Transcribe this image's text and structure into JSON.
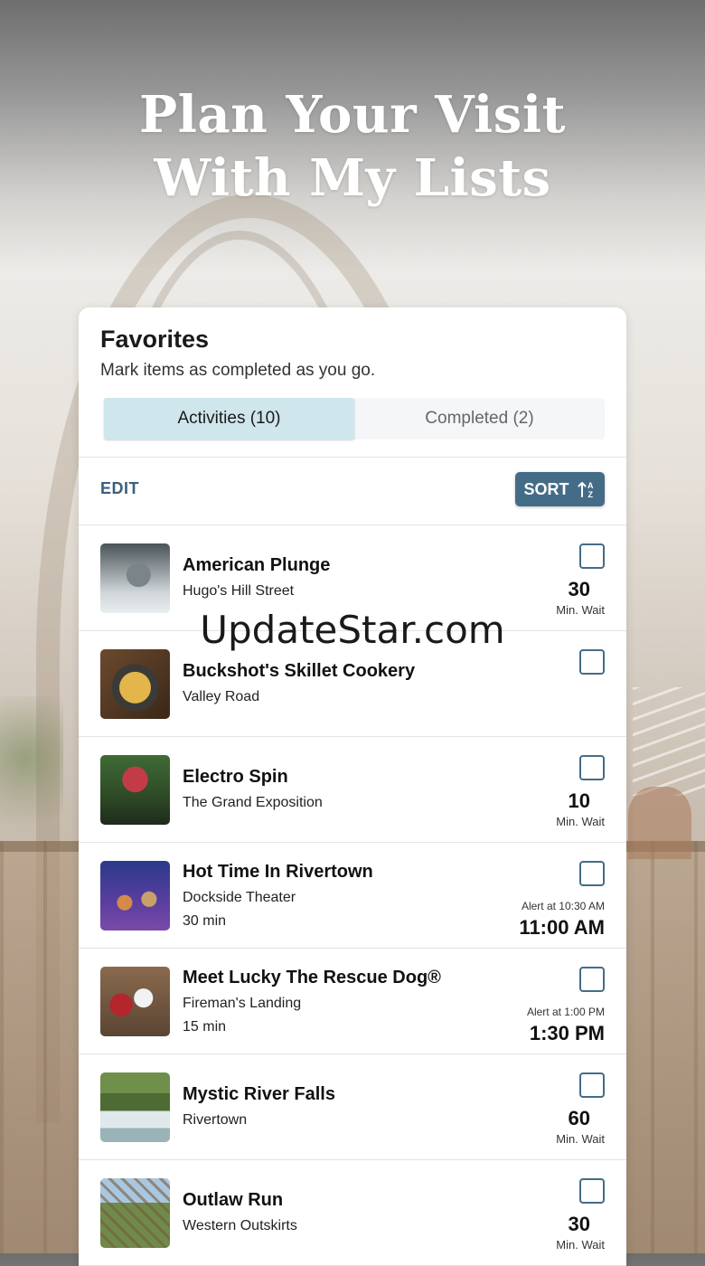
{
  "headline": {
    "line1": "Plan Your Visit",
    "line2": "With My Lists"
  },
  "card": {
    "title": "Favorites",
    "subtitle": "Mark items as completed as you go.",
    "tabs": [
      {
        "label": "Activities (10)",
        "active": true
      },
      {
        "label": "Completed (2)",
        "active": false
      }
    ]
  },
  "toolbar": {
    "edit_label": "EDIT",
    "sort_label": "SORT",
    "sort_icon": "sort-az-icon"
  },
  "items": [
    {
      "name": "American Plunge",
      "location": "Hugo's Hill Street",
      "wait": "30",
      "wait_label": "Min. Wait",
      "checked": false
    },
    {
      "name": "Buckshot's Skillet Cookery",
      "location": "Valley Road",
      "checked": false
    },
    {
      "name": "Electro Spin",
      "location": "The Grand Exposition",
      "wait": "10",
      "wait_label": "Min. Wait",
      "checked": false
    },
    {
      "name": "Hot Time In Rivertown",
      "location": "Dockside Theater",
      "duration": "30 min",
      "alert": "Alert at 10:30 AM",
      "time": "11:00 AM",
      "checked": false
    },
    {
      "name": "Meet Lucky The Rescue Dog®",
      "location": "Fireman's Landing",
      "duration": "15 min",
      "alert": "Alert at 1:00 PM",
      "time": "1:30 PM",
      "checked": false
    },
    {
      "name": "Mystic River Falls",
      "location": "Rivertown",
      "wait": "60",
      "wait_label": "Min. Wait",
      "checked": false
    },
    {
      "name": "Outlaw Run",
      "location": "Western Outskirts",
      "wait": "30",
      "wait_label": "Min. Wait",
      "checked": false
    }
  ],
  "watermark": "UpdateStar.com",
  "colors": {
    "accent": "#456c87",
    "active_tab": "#cfe6ec",
    "edit_text": "#3c5f7d"
  }
}
